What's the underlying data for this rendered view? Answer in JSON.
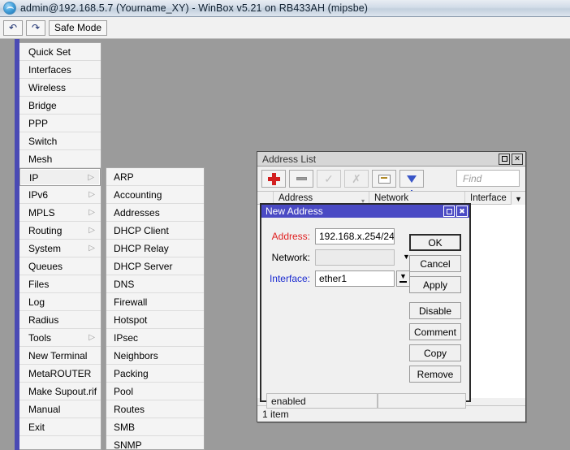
{
  "window": {
    "title": "admin@192.168.5.7 (Yourname_XY) - WinBox v5.21 on RB433AH (mipsbe)",
    "icon": "winbox-globe-icon"
  },
  "toolbar": {
    "undo_label": "↶",
    "redo_label": "↷",
    "safe_mode_label": "Safe Mode"
  },
  "sidebar": {
    "items": [
      {
        "label": "Quick Set",
        "submenu": false
      },
      {
        "label": "Interfaces",
        "submenu": false
      },
      {
        "label": "Wireless",
        "submenu": false
      },
      {
        "label": "Bridge",
        "submenu": false
      },
      {
        "label": "PPP",
        "submenu": false
      },
      {
        "label": "Switch",
        "submenu": false
      },
      {
        "label": "Mesh",
        "submenu": false
      },
      {
        "label": "IP",
        "submenu": true,
        "selected": true
      },
      {
        "label": "IPv6",
        "submenu": true
      },
      {
        "label": "MPLS",
        "submenu": true
      },
      {
        "label": "Routing",
        "submenu": true
      },
      {
        "label": "System",
        "submenu": true
      },
      {
        "label": "Queues",
        "submenu": false
      },
      {
        "label": "Files",
        "submenu": false
      },
      {
        "label": "Log",
        "submenu": false
      },
      {
        "label": "Radius",
        "submenu": false
      },
      {
        "label": "Tools",
        "submenu": true
      },
      {
        "label": "New Terminal",
        "submenu": false
      },
      {
        "label": "MetaROUTER",
        "submenu": false
      },
      {
        "label": "Make Supout.rif",
        "submenu": false
      },
      {
        "label": "Manual",
        "submenu": false
      },
      {
        "label": "Exit",
        "submenu": false
      }
    ],
    "submenu_arrow": "▷"
  },
  "ip_submenu": {
    "items": [
      {
        "label": "ARP"
      },
      {
        "label": "Accounting"
      },
      {
        "label": "Addresses"
      },
      {
        "label": "DHCP Client"
      },
      {
        "label": "DHCP Relay"
      },
      {
        "label": "DHCP Server"
      },
      {
        "label": "DNS"
      },
      {
        "label": "Firewall"
      },
      {
        "label": "Hotspot"
      },
      {
        "label": "IPsec"
      },
      {
        "label": "Neighbors"
      },
      {
        "label": "Packing"
      },
      {
        "label": "Pool"
      },
      {
        "label": "Routes"
      },
      {
        "label": "SMB"
      },
      {
        "label": "SNMP"
      }
    ]
  },
  "address_list": {
    "title": "Address List",
    "maximize_label": "",
    "close_label": "✕",
    "toolbar": {
      "add": "+",
      "remove": "−",
      "enable": "✓",
      "disable": "✗",
      "comment": "comment",
      "filter": "filter"
    },
    "find_placeholder": "Find",
    "columns": [
      "",
      "Address",
      "Network",
      "Interface"
    ],
    "sort_mark": "▾",
    "dropdown_arrow": "▼",
    "status": "1 item"
  },
  "new_address": {
    "title": "New Address",
    "maximize_label": "",
    "close_label": "✖",
    "fields": {
      "address_label": "Address:",
      "address_value": "192.168.x.254/24",
      "network_label": "Network:",
      "network_value": "",
      "interface_label": "Interface:",
      "interface_value": "ether1"
    },
    "buttons": {
      "ok": "OK",
      "cancel": "Cancel",
      "apply": "Apply",
      "disable": "Disable",
      "comment": "Comment",
      "copy": "Copy",
      "remove": "Remove"
    },
    "status_left": "enabled",
    "status_right": ""
  },
  "colors": {
    "desktop": "#9b9b9b",
    "rail": "#4a4ab4",
    "dialog_title": "#4a4ac4",
    "required_label": "#e02020",
    "link_label": "#1a2ad0",
    "add_icon": "#d21f1f",
    "filter_icon": "#3a56c8"
  }
}
